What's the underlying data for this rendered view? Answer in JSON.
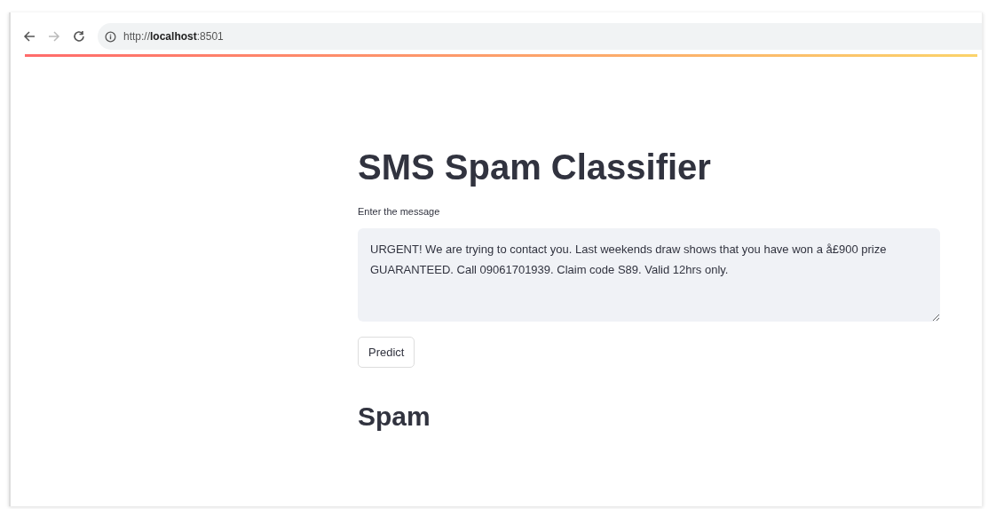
{
  "browser": {
    "url": "http://**localhost**:8501"
  },
  "app": {
    "title": "SMS Spam Classifier",
    "input_label": "Enter the message",
    "message": "URGENT! We are trying to contact you. Last weekends draw shows that you have won a å£900 prize GUARANTEED. Call 09061701939. Claim code S89. Valid 12hrs only.",
    "button": "Predict",
    "result": "Spam"
  }
}
